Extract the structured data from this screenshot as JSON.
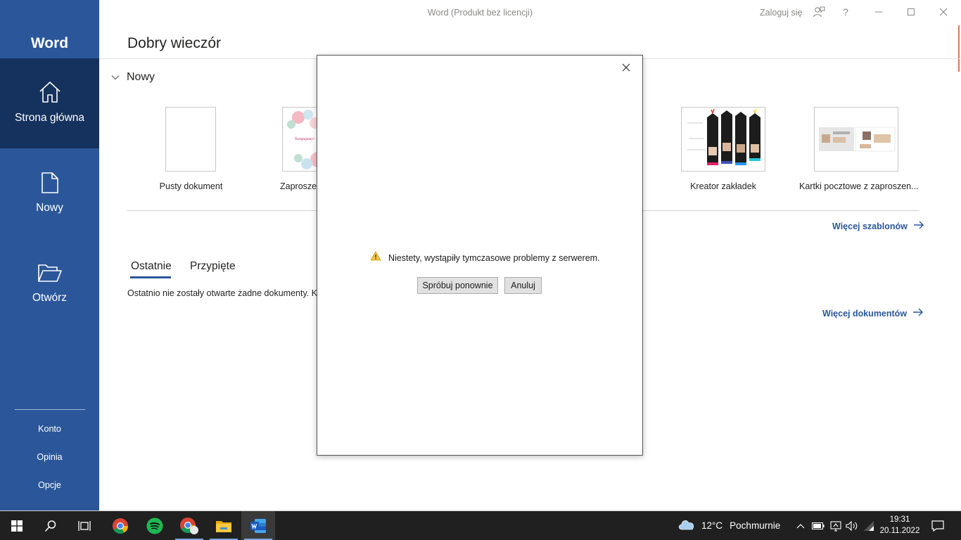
{
  "app": {
    "name": "Word",
    "window_title": "Word (Produkt bez licencji)",
    "sign_in": "Zaloguj się",
    "help": "?"
  },
  "sidebar": {
    "nav": [
      {
        "label": "Strona główna",
        "icon": "home-icon",
        "active": true
      },
      {
        "label": "Nowy",
        "icon": "new-document-icon"
      },
      {
        "label": "Otwórz",
        "icon": "open-folder-icon"
      }
    ],
    "bottom": [
      "Konto",
      "Opinia",
      "Opcje"
    ]
  },
  "main": {
    "greeting": "Dobry wieczór",
    "new_section": "Nowy",
    "templates": [
      {
        "label": "Pusty dokument"
      },
      {
        "label": "Zaproszen",
        "thumb_text": "Świętujemy!"
      },
      {
        "label": "Kreator zakładek"
      },
      {
        "label": "Kartki pocztowe z zaproszen..."
      }
    ],
    "more_templates": "Więcej szablonów",
    "tabs": [
      "Ostatnie",
      "Przypięte"
    ],
    "recent_empty": "Ostatnio nie zostały otwarte żadne dokumenty. Klik",
    "more_documents": "Więcej dokumentów"
  },
  "dialog": {
    "message": "Niestety, wystąpiły tymczasowe problemy z serwerem.",
    "retry": "Spróbuj ponownie",
    "cancel": "Anuluj"
  },
  "taskbar": {
    "weather_temp": "12°C",
    "weather_condition": "Pochmurnie",
    "time": "19:31",
    "date": "20.11.2022"
  },
  "colors": {
    "word_blue": "#2b579a",
    "sidebar_active": "#15315d",
    "taskbar": "#202020",
    "warning": "#f5c542"
  }
}
